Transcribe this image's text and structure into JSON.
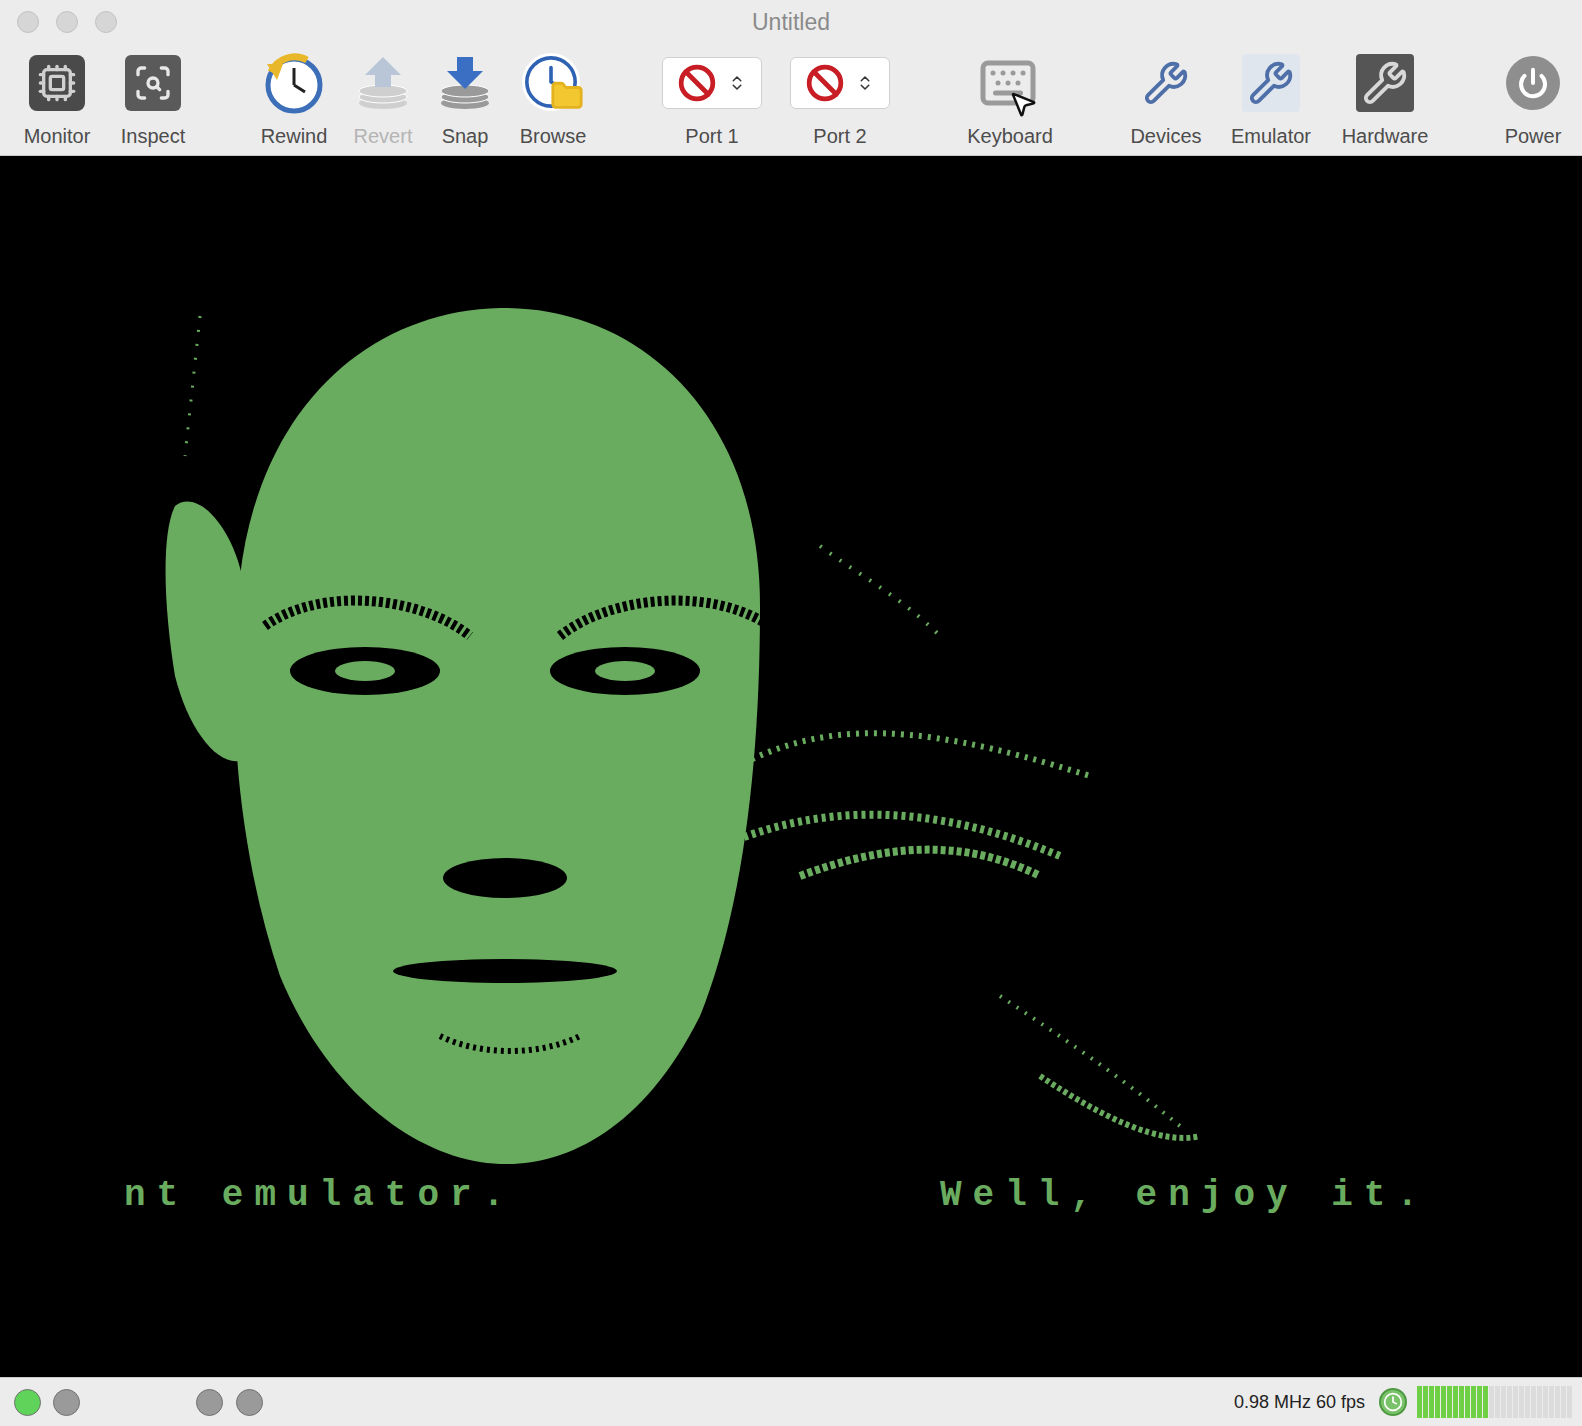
{
  "window": {
    "title": "Untitled"
  },
  "toolbar": [
    {
      "label": "Monitor",
      "kind": "button",
      "disabled": false
    },
    {
      "label": "Inspect",
      "kind": "button",
      "disabled": false
    },
    {
      "label": "Rewind",
      "kind": "button",
      "disabled": false
    },
    {
      "label": "Revert",
      "kind": "button",
      "disabled": true
    },
    {
      "label": "Snap",
      "kind": "button",
      "disabled": false
    },
    {
      "label": "Browse",
      "kind": "button",
      "disabled": false
    },
    {
      "label": "Port 1",
      "kind": "dropdown",
      "disabled": false
    },
    {
      "label": "Port 2",
      "kind": "dropdown",
      "disabled": false
    },
    {
      "label": "Keyboard",
      "kind": "button",
      "disabled": false
    },
    {
      "label": "Devices",
      "kind": "button",
      "disabled": false
    },
    {
      "label": "Emulator",
      "kind": "button",
      "disabled": false
    },
    {
      "label": "Hardware",
      "kind": "button",
      "disabled": false
    },
    {
      "label": "Power",
      "kind": "button",
      "disabled": false
    }
  ],
  "screen": {
    "scroller": [
      "nt emulator.",
      "Well, enjoy it."
    ]
  },
  "status_bar": {
    "leds": [
      {
        "on": true,
        "color": "#5fd35a"
      },
      {
        "on": false,
        "color": "#9a9a9a"
      },
      {
        "on": false,
        "color": "#9a9a9a"
      },
      {
        "on": false,
        "color": "#9a9a9a"
      }
    ],
    "speed": "0.98 MHz 60 fps",
    "meter": {
      "level": 0.45
    }
  }
}
